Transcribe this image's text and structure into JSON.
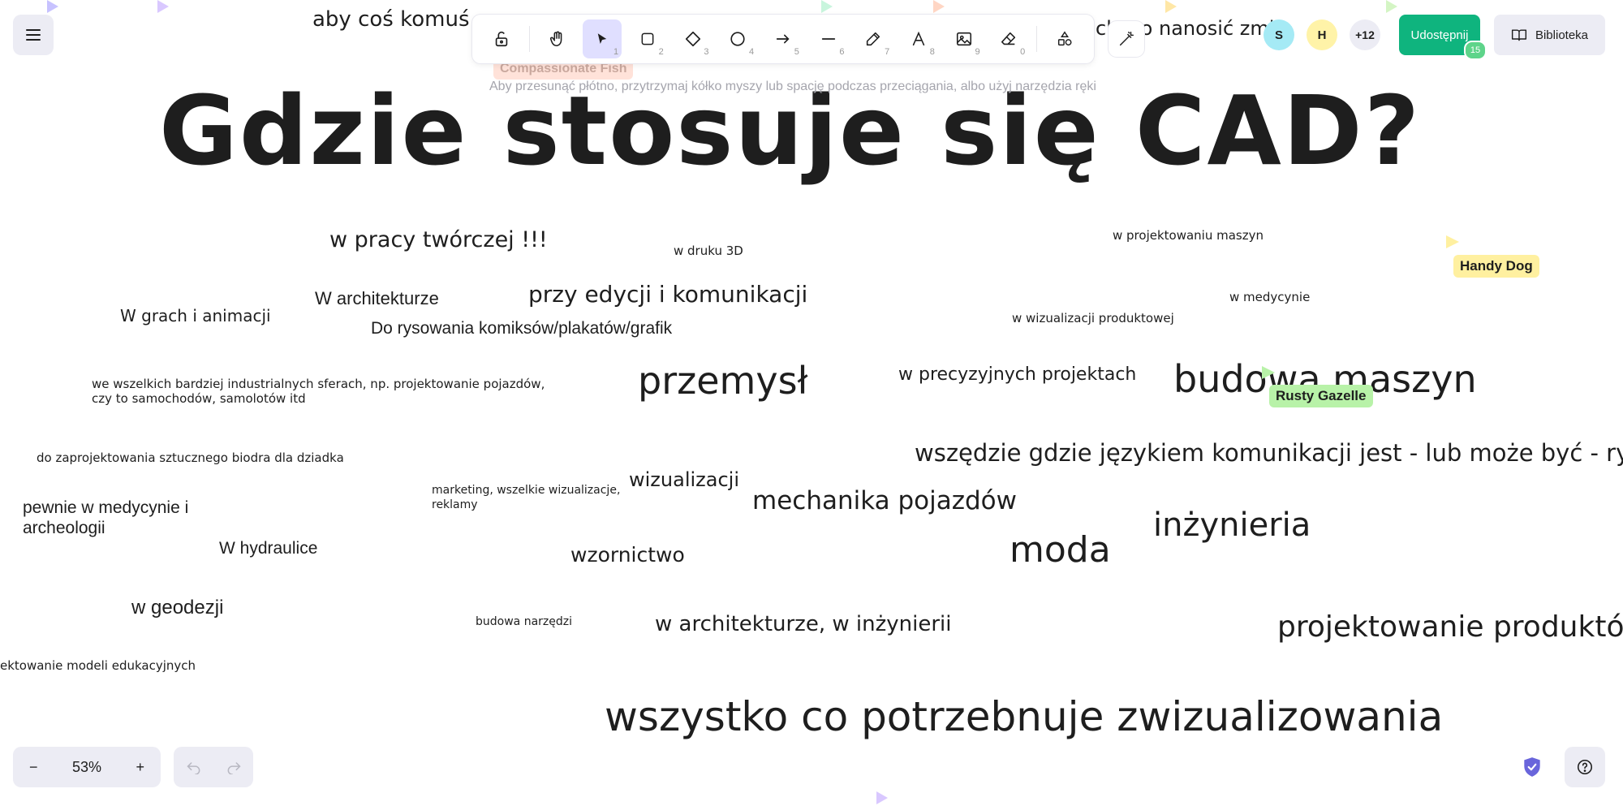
{
  "canvas": {
    "title": "Gdzie stosuje się CAD?",
    "top_partial_left": "aby coś komuś",
    "top_partial_right": "ch wo nanosić zmi",
    "words": [
      {
        "id": "w1",
        "text": "w pracy twórczej !!!"
      },
      {
        "id": "w2",
        "text": "w druku 3D"
      },
      {
        "id": "w3",
        "text": "w projektowaniu maszyn"
      },
      {
        "id": "w4",
        "text": "W architekturze"
      },
      {
        "id": "w5",
        "text": "przy edycji i komunikacji"
      },
      {
        "id": "w6",
        "text": "W grach i animacji"
      },
      {
        "id": "w7",
        "text": "Do rysowania komiksów/plakatów/grafik"
      },
      {
        "id": "w8",
        "text": "w medycynie"
      },
      {
        "id": "w9",
        "text": "w wizualizacji produktowej"
      },
      {
        "id": "w10",
        "text": "we wszelkich bardziej industrialnych sferach, np. projektowanie pojazdów,"
      },
      {
        "id": "w10b",
        "text": "czy to samochodów, samolotów itd"
      },
      {
        "id": "w11",
        "text": "przemysł"
      },
      {
        "id": "w12",
        "text": "w precyzyjnych projektach"
      },
      {
        "id": "w13",
        "text": "budowa maszyn"
      },
      {
        "id": "w14",
        "text": "do zaprojektowania sztucznego biodra dla dziadka"
      },
      {
        "id": "w15",
        "text": "wszędzie gdzie językiem komunikacji jest - lub może być - rysun"
      },
      {
        "id": "w16",
        "text": "marketing, wszelkie wizualizacje,"
      },
      {
        "id": "w16b",
        "text": "reklamy"
      },
      {
        "id": "w17",
        "text": "wizualizacji"
      },
      {
        "id": "w18",
        "text": "pewnie w medycynie i"
      },
      {
        "id": "w18b",
        "text": "archeologii"
      },
      {
        "id": "w19",
        "text": "mechanika pojazdów"
      },
      {
        "id": "w20",
        "text": "inżynieria"
      },
      {
        "id": "w21",
        "text": "W hydraulice"
      },
      {
        "id": "w22",
        "text": "wzornictwo"
      },
      {
        "id": "w23",
        "text": "moda"
      },
      {
        "id": "w24",
        "text": "w geodezji"
      },
      {
        "id": "w25",
        "text": "budowa narzędzi"
      },
      {
        "id": "w26",
        "text": "w architekturze, w inżynierii"
      },
      {
        "id": "w27",
        "text": "projektowanie produktów"
      },
      {
        "id": "w28",
        "text": "ektowanie modeli edukacyjnych"
      },
      {
        "id": "w29",
        "text": "wszystko co potrzebnuje zwizualizowania"
      }
    ]
  },
  "toolbar": {
    "tools": [
      {
        "name": "lock",
        "key": ""
      },
      {
        "name": "hand",
        "key": ""
      },
      {
        "name": "selection",
        "key": "1"
      },
      {
        "name": "rectangle",
        "key": "2"
      },
      {
        "name": "diamond",
        "key": "3"
      },
      {
        "name": "ellipse",
        "key": "4"
      },
      {
        "name": "arrow",
        "key": "5"
      },
      {
        "name": "line",
        "key": "6"
      },
      {
        "name": "draw",
        "key": "7"
      },
      {
        "name": "text",
        "key": "8"
      },
      {
        "name": "image",
        "key": "9"
      },
      {
        "name": "eraser",
        "key": "0"
      },
      {
        "name": "shapes",
        "key": ""
      }
    ],
    "hint": "Aby przesunąć płótno, przytrzymaj kółko myszy lub spację podczas przeciągania, albo użyj narzędzia ręki"
  },
  "collab": {
    "avatars": [
      {
        "initial": "S",
        "color": "#a5eaf5"
      },
      {
        "initial": "H",
        "color": "#fff3a8"
      }
    ],
    "more": "+12",
    "share_label": "Udostępnij",
    "share_count": "15",
    "library_label": "Biblioteka"
  },
  "cursors": [
    {
      "name": "Compassionate Fish",
      "color": "#ffd6cc"
    },
    {
      "name": "Handy Dog",
      "color": "#fff0a0"
    },
    {
      "name": "Rusty Gazelle",
      "color": "#b8f2a8"
    }
  ],
  "zoom": {
    "level": "53%",
    "minus": "−",
    "plus": "+"
  }
}
